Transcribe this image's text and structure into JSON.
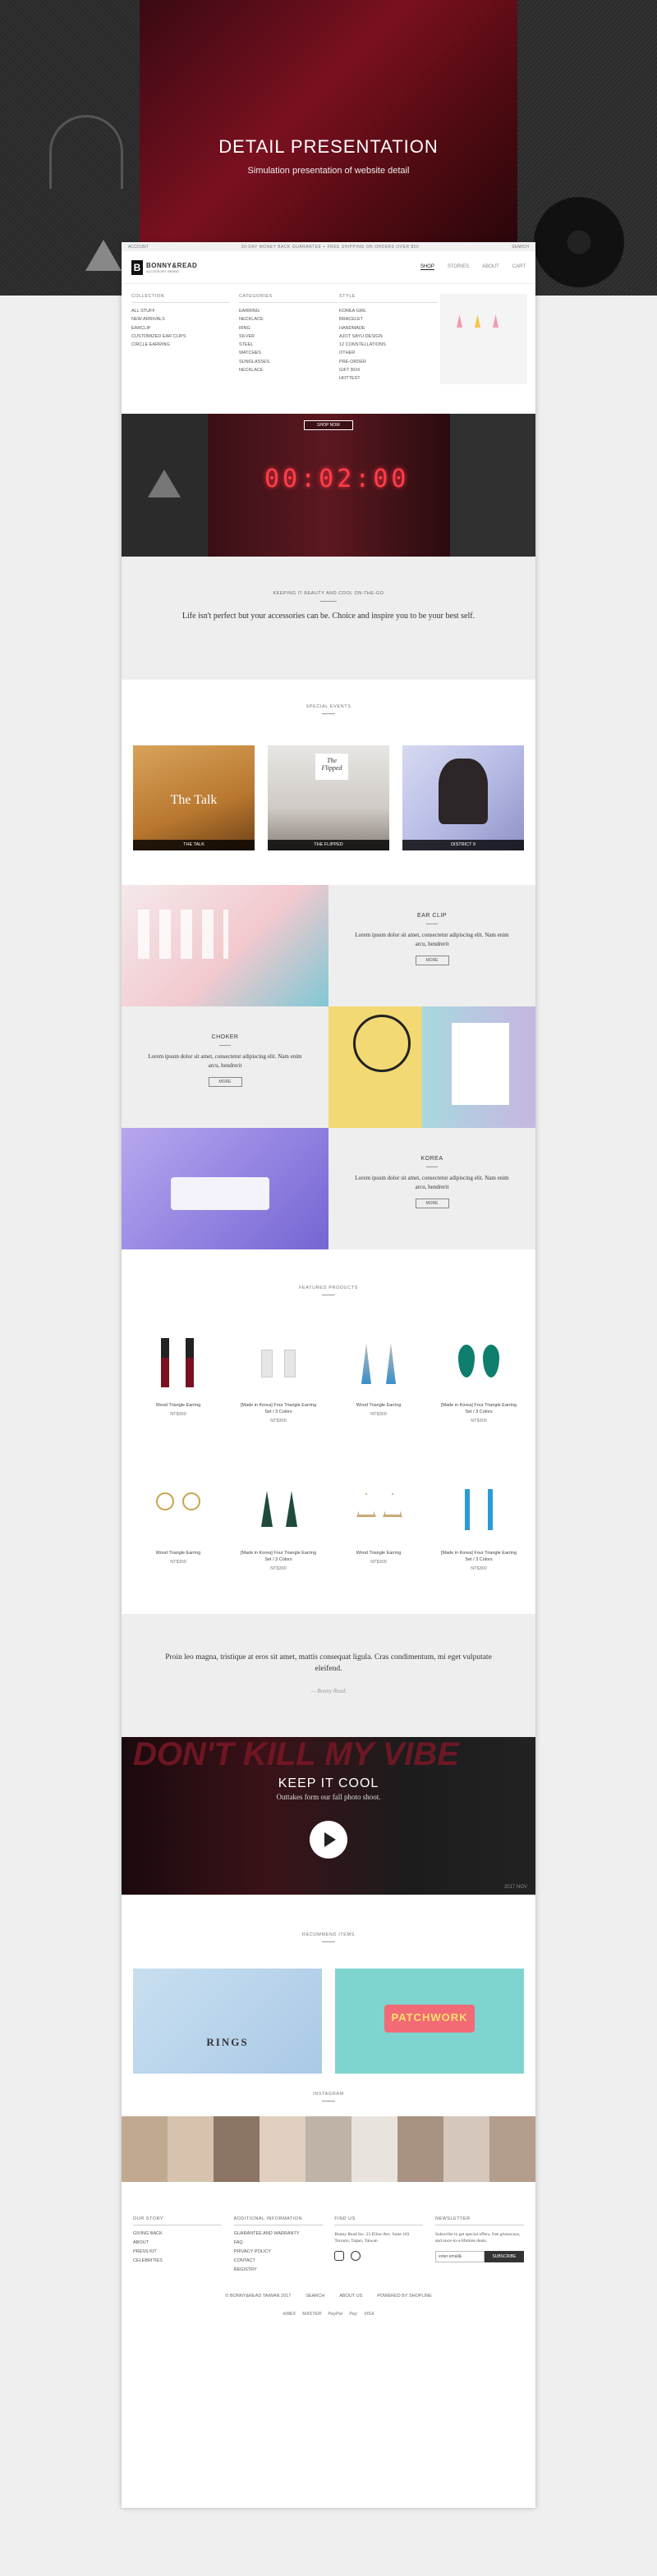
{
  "hero": {
    "title": "DETAIL PRESENTATION",
    "subtitle": "Simulation presentation of website detail"
  },
  "topbar": {
    "left": "ACCOUNT",
    "promo": "30-DAY MONEY BACK GUARANTEE + FREE SHIPPING ON ORDERS OVER $50",
    "right": "SEARCH"
  },
  "logo": {
    "mark": "B",
    "name": "BONNY&READ",
    "tag": "ACCESSORY BRAND"
  },
  "nav": {
    "items": [
      "SHOP",
      "STORIES",
      "ABOUT",
      "CART"
    ]
  },
  "mega": {
    "collection": {
      "title": "COLLECTION",
      "items": [
        "ALL STUFF",
        "NEW ARRIVALS",
        "EARCLIP",
        "CUSTOMIZED EAR CLIPS",
        "CIRCLE EARRING"
      ]
    },
    "categories": {
      "title": "CATEGORIES",
      "items": [
        "EARRING",
        "NECKLACE",
        "RING",
        "SILVER",
        "STEEL",
        "WATCHES",
        "SUNGLASSES",
        "NECKLACE"
      ]
    },
    "style": {
      "title": "STYLE",
      "items": [
        "KOREA GIRL",
        "BRACELET",
        "HANDMADE",
        "AJOT SAYU DESIGN",
        "12 CONSTELLATIONS",
        "OTHER",
        "PRE-ORDER",
        "GIFT BOX",
        "HOTTEST"
      ]
    }
  },
  "banner": {
    "button": "SHOP NOW",
    "clock": "00:02:00"
  },
  "tagline": {
    "kicker": "KEEPING IT BEAUTY AND COOL ON-THE-GO",
    "quote": "Life isn't perfect but your accessories can be. Choice and inspire you to be your best self."
  },
  "events": {
    "title": "SPECIAL EVENTS",
    "items": [
      {
        "caption": "THE TALK",
        "overlay": "The Talk"
      },
      {
        "caption": "THE FLIPPED",
        "overlay": "The Flipped"
      },
      {
        "caption": "DISTRICT 9",
        "overlay": ""
      }
    ]
  },
  "cats": [
    {
      "title": "EAR CLIP",
      "text": "Lorem ipsum dolor sit amet, consectetur adipiscing elit. Nam enim arcu, hendrerit",
      "more": "MORE"
    },
    {
      "title": "CHOKER",
      "text": "Lorem ipsum dolor sit amet, consectetur adipiscing elit. Nam enim arcu, hendrerit",
      "more": "MORE"
    },
    {
      "title": "KOREA",
      "text": "Lorem ipsum dolor sit amet, consectetur adipiscing elit. Nam enim arcu, hendrerit",
      "more": "MORE"
    }
  ],
  "featured": {
    "title": "FEATURED PRODUCTS",
    "products": [
      {
        "name": "Wood Triangle Earring",
        "price": "NT$300"
      },
      {
        "name": "[Made in Korea] Four Triangle Earring Set / 3 Colors",
        "price": "NT$300"
      },
      {
        "name": "Wood Triangle Earring",
        "price": "NT$300"
      },
      {
        "name": "[Made in Korea] Four Triangle Earring Set / 3 Colors",
        "price": "NT$300"
      },
      {
        "name": "Wood Triangle Earring",
        "price": "NT$300"
      },
      {
        "name": "[Made in Korea] Four Triangle Earring Set / 3 Colors",
        "price": "NT$300"
      },
      {
        "name": "Wood Triangle Earring",
        "price": "NT$300"
      },
      {
        "name": "[Made in Korea] Four Triangle Earring Set / 3 Colors",
        "price": "NT$300"
      }
    ]
  },
  "quote": {
    "text": "Proin leo magna, tristique at eros sit amet, mattis consequat ligula. Cras condimentum, mi eget vulputate eleifend.",
    "author": "— Bonny Read."
  },
  "video": {
    "graffiti": "DON'T KILL MY VIBE",
    "title": "KEEP IT COOL",
    "subtitle": "Outtakes form our fall photo shoot.",
    "stamp": "2017 NOV"
  },
  "recommend": {
    "title": "RECOMMEND ITEMS",
    "cards": [
      {
        "label": "RINGS"
      },
      {
        "label": "PATCHWORK"
      }
    ]
  },
  "instagram": {
    "title": "INSTAGRAM"
  },
  "footer": {
    "story": {
      "title": "OUR STORY",
      "items": [
        "GIVING BACK",
        "ABOUT",
        "PRESS KIT",
        "CELEBRITIES"
      ]
    },
    "info": {
      "title": "ADDITIONAL INFORMATION",
      "items": [
        "GUARANTEE AND WARRANTY",
        "FAQ",
        "PRIVACY POLICY",
        "CONTACT",
        "REGISTRY"
      ]
    },
    "findus": {
      "title": "FIND US",
      "address": "Bonny Read Inc. 23 Elliot Ave. Suite 103 Toronto, Taipei, Taiwan"
    },
    "newsletter": {
      "title": "NEWSLETTER",
      "text": "Subscribe to get special offers, free giveaways, and once-in-a-lifetime deals.",
      "placeholder": "enter email&",
      "button": "SUBSCRIBE"
    },
    "links": [
      "© BONNY&READ TAIWAN 2017",
      "SEARCH",
      "ABOUT US",
      "POWERED BY SHOPLINE"
    ],
    "payments": [
      "AMEX",
      "MASTER",
      "PayPal",
      "Pay",
      "VISA"
    ]
  },
  "colors": {
    "accent": "#d61f2c",
    "hero_red": "#7a1020",
    "panel_gray": "#eeeeee",
    "clock": "#ff3f4a"
  }
}
